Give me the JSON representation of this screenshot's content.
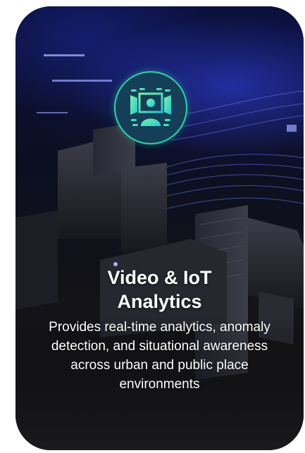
{
  "card": {
    "title": "Video & IoT Analytics",
    "description": "Provides real-time analytics, anomaly detection, and situational awareness across urban and public place environments",
    "icon": "video-analytics-icon",
    "colors": {
      "badge_ring": "#2fd1a7",
      "badge_fill": "#153f58",
      "icon_gradient_start": "#7ef2a6",
      "icon_gradient_end": "#22c7d8",
      "text": "#ffffff"
    }
  }
}
